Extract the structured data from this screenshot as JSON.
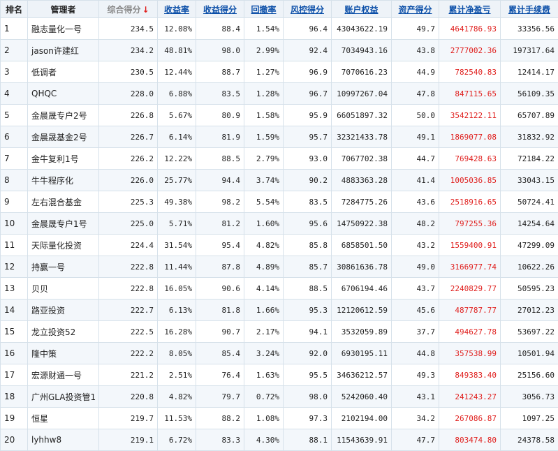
{
  "headers": {
    "rank": "排名",
    "manager": "管理者",
    "score": "综合得分",
    "sort_arrow": "↓",
    "return_rate": "收益率",
    "return_score": "收益得分",
    "drawdown": "回撤率",
    "risk_score": "风控得分",
    "equity": "账户权益",
    "asset_score": "资产得分",
    "net_pnl": "累计净盈亏",
    "fees": "累计手续费"
  },
  "colors": {
    "header_link": "#0b4fa8",
    "pnl_red": "#e0211f",
    "sort_arrow_red": "#e0211f",
    "grid_border": "#d6e1ea",
    "header_bg": "#eef3f8"
  },
  "rows": [
    {
      "rank": "1",
      "manager": "融志量化一号",
      "score": "234.5",
      "return_rate": "12.08%",
      "return_score": "88.4",
      "drawdown": "1.54%",
      "risk_score": "96.4",
      "equity": "43043622.19",
      "asset_score": "49.7",
      "net_pnl": "4641786.93",
      "fees": "33356.56"
    },
    {
      "rank": "2",
      "manager": "jason许建红",
      "score": "234.2",
      "return_rate": "48.81%",
      "return_score": "98.0",
      "drawdown": "2.99%",
      "risk_score": "92.4",
      "equity": "7034943.16",
      "asset_score": "43.8",
      "net_pnl": "2777002.36",
      "fees": "197317.64"
    },
    {
      "rank": "3",
      "manager": "低调者",
      "score": "230.5",
      "return_rate": "12.44%",
      "return_score": "88.7",
      "drawdown": "1.27%",
      "risk_score": "96.9",
      "equity": "7070616.23",
      "asset_score": "44.9",
      "net_pnl": "782540.83",
      "fees": "12414.17"
    },
    {
      "rank": "4",
      "manager": "QHQC",
      "score": "228.0",
      "return_rate": "6.88%",
      "return_score": "83.5",
      "drawdown": "1.28%",
      "risk_score": "96.7",
      "equity": "10997267.04",
      "asset_score": "47.8",
      "net_pnl": "847115.65",
      "fees": "56109.35"
    },
    {
      "rank": "5",
      "manager": "金晨晟专户2号",
      "score": "226.8",
      "return_rate": "5.67%",
      "return_score": "80.9",
      "drawdown": "1.58%",
      "risk_score": "95.9",
      "equity": "66051897.32",
      "asset_score": "50.0",
      "net_pnl": "3542122.11",
      "fees": "65707.89"
    },
    {
      "rank": "6",
      "manager": "金晨晟基金2号",
      "score": "226.7",
      "return_rate": "6.14%",
      "return_score": "81.9",
      "drawdown": "1.59%",
      "risk_score": "95.7",
      "equity": "32321433.78",
      "asset_score": "49.1",
      "net_pnl": "1869077.08",
      "fees": "31832.92"
    },
    {
      "rank": "7",
      "manager": "金牛复利1号",
      "score": "226.2",
      "return_rate": "12.22%",
      "return_score": "88.5",
      "drawdown": "2.79%",
      "risk_score": "93.0",
      "equity": "7067702.38",
      "asset_score": "44.7",
      "net_pnl": "769428.63",
      "fees": "72184.22"
    },
    {
      "rank": "8",
      "manager": "牛牛程序化",
      "score": "226.0",
      "return_rate": "25.77%",
      "return_score": "94.4",
      "drawdown": "3.74%",
      "risk_score": "90.2",
      "equity": "4883363.28",
      "asset_score": "41.4",
      "net_pnl": "1005036.85",
      "fees": "33043.15"
    },
    {
      "rank": "9",
      "manager": "左右混合基金",
      "score": "225.3",
      "return_rate": "49.38%",
      "return_score": "98.2",
      "drawdown": "5.54%",
      "risk_score": "83.5",
      "equity": "7284775.26",
      "asset_score": "43.6",
      "net_pnl": "2518916.65",
      "fees": "50724.41"
    },
    {
      "rank": "10",
      "manager": "金晨晟专户1号",
      "score": "225.0",
      "return_rate": "5.71%",
      "return_score": "81.2",
      "drawdown": "1.60%",
      "risk_score": "95.6",
      "equity": "14750922.38",
      "asset_score": "48.2",
      "net_pnl": "797255.36",
      "fees": "14254.64"
    },
    {
      "rank": "11",
      "manager": "天际量化投资",
      "score": "224.4",
      "return_rate": "31.54%",
      "return_score": "95.4",
      "drawdown": "4.82%",
      "risk_score": "85.8",
      "equity": "6858501.50",
      "asset_score": "43.2",
      "net_pnl": "1559400.91",
      "fees": "47299.09"
    },
    {
      "rank": "12",
      "manager": "持赢一号",
      "score": "222.8",
      "return_rate": "11.44%",
      "return_score": "87.8",
      "drawdown": "4.89%",
      "risk_score": "85.7",
      "equity": "30861636.78",
      "asset_score": "49.0",
      "net_pnl": "3166977.74",
      "fees": "10622.26"
    },
    {
      "rank": "13",
      "manager": "贝贝",
      "score": "222.8",
      "return_rate": "16.05%",
      "return_score": "90.6",
      "drawdown": "4.14%",
      "risk_score": "88.5",
      "equity": "6706194.46",
      "asset_score": "43.7",
      "net_pnl": "2240829.77",
      "fees": "50595.23"
    },
    {
      "rank": "14",
      "manager": "路亚投资",
      "score": "222.7",
      "return_rate": "6.13%",
      "return_score": "81.8",
      "drawdown": "1.66%",
      "risk_score": "95.3",
      "equity": "12120612.59",
      "asset_score": "45.6",
      "net_pnl": "487787.77",
      "fees": "27012.23"
    },
    {
      "rank": "15",
      "manager": "龙立投资52",
      "score": "222.5",
      "return_rate": "16.28%",
      "return_score": "90.7",
      "drawdown": "2.17%",
      "risk_score": "94.1",
      "equity": "3532059.89",
      "asset_score": "37.7",
      "net_pnl": "494627.78",
      "fees": "53697.22"
    },
    {
      "rank": "16",
      "manager": "隆中策",
      "score": "222.2",
      "return_rate": "8.05%",
      "return_score": "85.4",
      "drawdown": "3.24%",
      "risk_score": "92.0",
      "equity": "6930195.11",
      "asset_score": "44.8",
      "net_pnl": "357538.99",
      "fees": "10501.94"
    },
    {
      "rank": "17",
      "manager": "宏源财通一号",
      "score": "221.2",
      "return_rate": "2.51%",
      "return_score": "76.4",
      "drawdown": "1.63%",
      "risk_score": "95.5",
      "equity": "34636212.57",
      "asset_score": "49.3",
      "net_pnl": "849383.40",
      "fees": "25156.60"
    },
    {
      "rank": "18",
      "manager": "广州GLA投资管1",
      "score": "220.8",
      "return_rate": "4.82%",
      "return_score": "79.7",
      "drawdown": "0.72%",
      "risk_score": "98.0",
      "equity": "5242060.40",
      "asset_score": "43.1",
      "net_pnl": "241243.27",
      "fees": "3056.73"
    },
    {
      "rank": "19",
      "manager": "恒星",
      "score": "219.7",
      "return_rate": "11.53%",
      "return_score": "88.2",
      "drawdown": "1.08%",
      "risk_score": "97.3",
      "equity": "2102194.00",
      "asset_score": "34.2",
      "net_pnl": "267086.87",
      "fees": "1097.25"
    },
    {
      "rank": "20",
      "manager": "lyhhw8",
      "score": "219.1",
      "return_rate": "6.72%",
      "return_score": "83.3",
      "drawdown": "4.30%",
      "risk_score": "88.1",
      "equity": "11543639.91",
      "asset_score": "47.7",
      "net_pnl": "803474.80",
      "fees": "24378.58"
    }
  ]
}
